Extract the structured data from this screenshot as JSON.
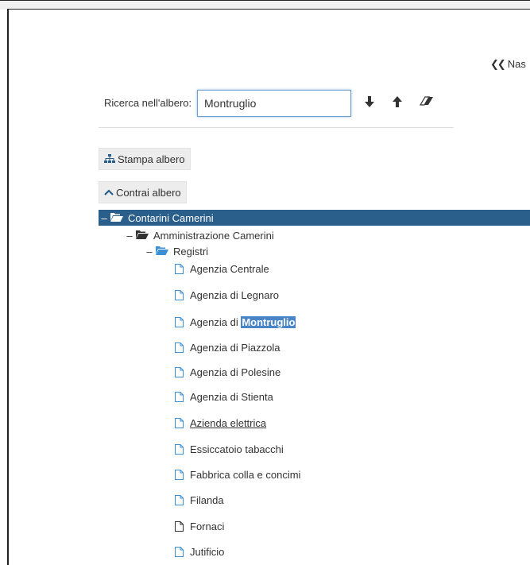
{
  "header": {
    "hide_label": "Nas"
  },
  "search": {
    "label": "Ricerca nell'albero:",
    "value": "Montruglio"
  },
  "buttons": {
    "print_tree": "Stampa albero",
    "collapse_tree": "Contrai albero"
  },
  "tree": {
    "root": "Contarini Camerini",
    "level1": "Amministrazione Camerini",
    "level2": "Registri",
    "leaves": [
      "Agenzia Centrale",
      "Agenzia di Legnaro",
      "Agenzia di ",
      "Agenzia di Piazzola",
      "Agenzia di Polesine",
      "Agenzia di Stienta",
      "Azienda elettrica",
      "Essiccatoio tabacchi",
      "Fabbrica colla e concimi",
      "Filanda",
      "Fornaci",
      "Jutificio"
    ],
    "highlight": "Montruglio"
  },
  "colors": {
    "selected_row": "#2b5f8b",
    "folder_blue": "#3a8fd6",
    "highlight": "#4a86c7"
  }
}
